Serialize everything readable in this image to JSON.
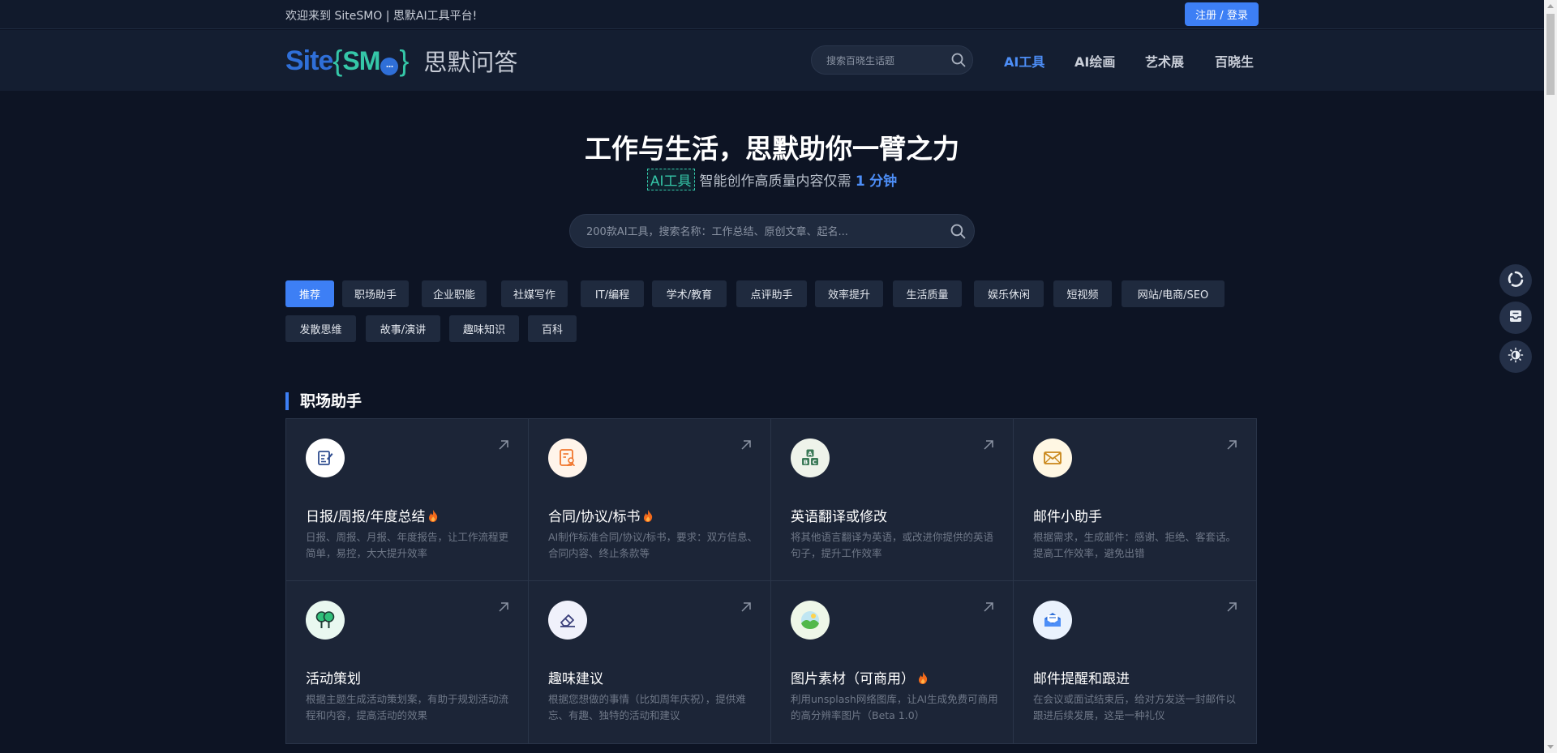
{
  "topbar": {
    "welcome": "欢迎来到 SiteSMO | 思默AI工具平台!",
    "login_label": "注册 / 登录"
  },
  "header": {
    "logo": {
      "site": "Site",
      "smo": "SMO",
      "cn": "思默问答"
    },
    "search_placeholder": "搜索百晓生话题",
    "nav": [
      {
        "label": "AI工具",
        "active": true
      },
      {
        "label": "AI绘画",
        "active": false
      },
      {
        "label": "艺术展",
        "active": false
      },
      {
        "label": "百晓生",
        "active": false
      }
    ]
  },
  "hero": {
    "title": "工作与生活，思默助你一臂之力",
    "tag": "AI工具",
    "subtitle_pre": "智能创作高质量内容仅需",
    "subtitle_num": "1",
    "subtitle_unit": "分钟",
    "search_placeholder": "200款AI工具，搜索名称：工作总结、原创文章、起名..."
  },
  "categories": [
    {
      "label": "推荐",
      "active": true
    },
    {
      "label": "职场助手"
    },
    {
      "label": "企业职能"
    },
    {
      "label": "社媒写作"
    },
    {
      "label": "IT/编程"
    },
    {
      "label": "学术/教育"
    },
    {
      "label": "点评助手"
    },
    {
      "label": "效率提升"
    },
    {
      "label": "生活质量"
    },
    {
      "label": "娱乐休闲"
    },
    {
      "label": "短视频"
    },
    {
      "label": "网站/电商/SEO"
    },
    {
      "label": "发散思维"
    },
    {
      "label": "故事/演讲"
    },
    {
      "label": "趣味知识"
    },
    {
      "label": "百科"
    }
  ],
  "section": {
    "title": "职场助手",
    "cards": [
      {
        "title": "日报/周报/年度总结",
        "hot": true,
        "icon": "document-edit-icon",
        "desc": "日报、周报、月报、年度报告，让工作流程更简单，易控，大大提升效率"
      },
      {
        "title": "合同/协议/标书",
        "hot": true,
        "icon": "contract-icon",
        "desc": "AI制作标准合同/协议/标书，要求：双方信息、合同内容、终止条款等"
      },
      {
        "title": "英语翻译或修改",
        "hot": false,
        "icon": "abc-blocks-icon",
        "desc": "将其他语言翻译为英语，或改进你提供的英语句子，提升工作效率"
      },
      {
        "title": "邮件小助手",
        "hot": false,
        "icon": "envelope-icon",
        "desc": "根据需求，生成邮件：感谢、拒绝、客套话。提高工作效率，避免出错"
      },
      {
        "title": "活动策划",
        "hot": false,
        "icon": "trees-icon",
        "desc": "根据主题生成活动策划案，有助于规划活动流程和内容，提高活动的效果"
      },
      {
        "title": "趣味建议",
        "hot": false,
        "icon": "eraser-icon",
        "desc": "根据您想做的事情（比如周年庆祝），提供难忘、有趣、独特的活动和建议"
      },
      {
        "title": "图片素材（可商用）",
        "hot": true,
        "icon": "landscape-image-icon",
        "desc": "利用unsplash网络图库，让AI生成免费可商用的高分辨率图片（Beta 1.0）"
      },
      {
        "title": "邮件提醒和跟进",
        "hot": false,
        "icon": "open-mail-icon",
        "desc": "在会议或面试结束后，给对方发送一封邮件以跟进后续发展，这是一种礼仪"
      }
    ]
  },
  "floating": [
    {
      "icon": "refresh-icon"
    },
    {
      "icon": "inbox-icon"
    },
    {
      "icon": "theme-toggle-icon"
    }
  ],
  "colors": {
    "background": "#0d1424",
    "accent": "#3d7ff5",
    "teal": "#35c7a8",
    "card": "#1c2537"
  }
}
